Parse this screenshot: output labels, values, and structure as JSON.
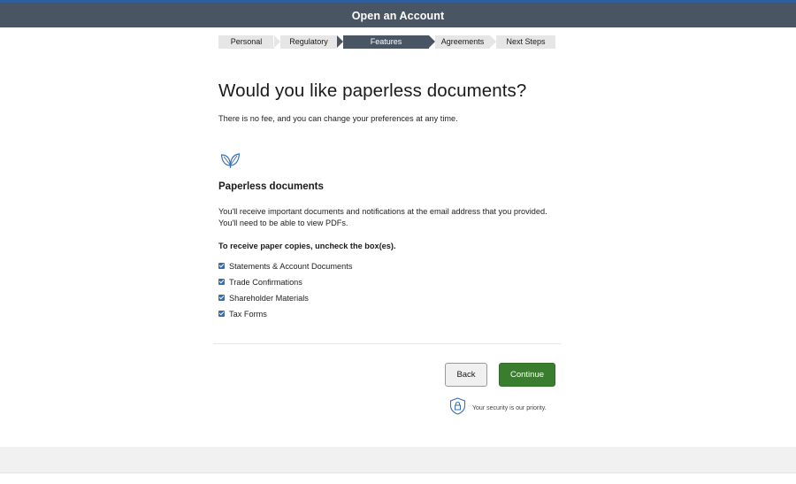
{
  "header": {
    "title": "Open an Account"
  },
  "stepper": {
    "steps": [
      {
        "label": "Personal",
        "active": false
      },
      {
        "label": "Regulatory",
        "active": false
      },
      {
        "label": "Features",
        "active": true
      },
      {
        "label": "Agreements",
        "active": false
      },
      {
        "label": "Next Steps",
        "active": false
      }
    ]
  },
  "main": {
    "heading": "Would you like paperless documents?",
    "subtext": "There is no fee, and you can change your preferences at any time.",
    "icon": "leaf-icon",
    "section_title": "Paperless documents",
    "description_line1": "You'll receive important documents and notifications at the email address that you provided.",
    "description_line2": "You'll need to be able to view PDFs.",
    "instruction": "To receive paper copies, uncheck the box(es).",
    "checkboxes": [
      {
        "label": "Statements & Account Documents",
        "checked": true
      },
      {
        "label": "Trade Confirmations",
        "checked": true
      },
      {
        "label": "Shareholder Materials",
        "checked": true
      },
      {
        "label": "Tax Forms",
        "checked": true
      }
    ]
  },
  "actions": {
    "back_label": "Back",
    "continue_label": "Continue"
  },
  "security": {
    "icon": "shield-lock-icon",
    "text": "Your security is our priority."
  },
  "colors": {
    "header_bg": "#4a5563",
    "header_accent": "#2f5f9e",
    "primary_button": "#3b7d2f",
    "checkbox": "#2f6fb5",
    "stepper_inactive": "#e6e6e6"
  }
}
